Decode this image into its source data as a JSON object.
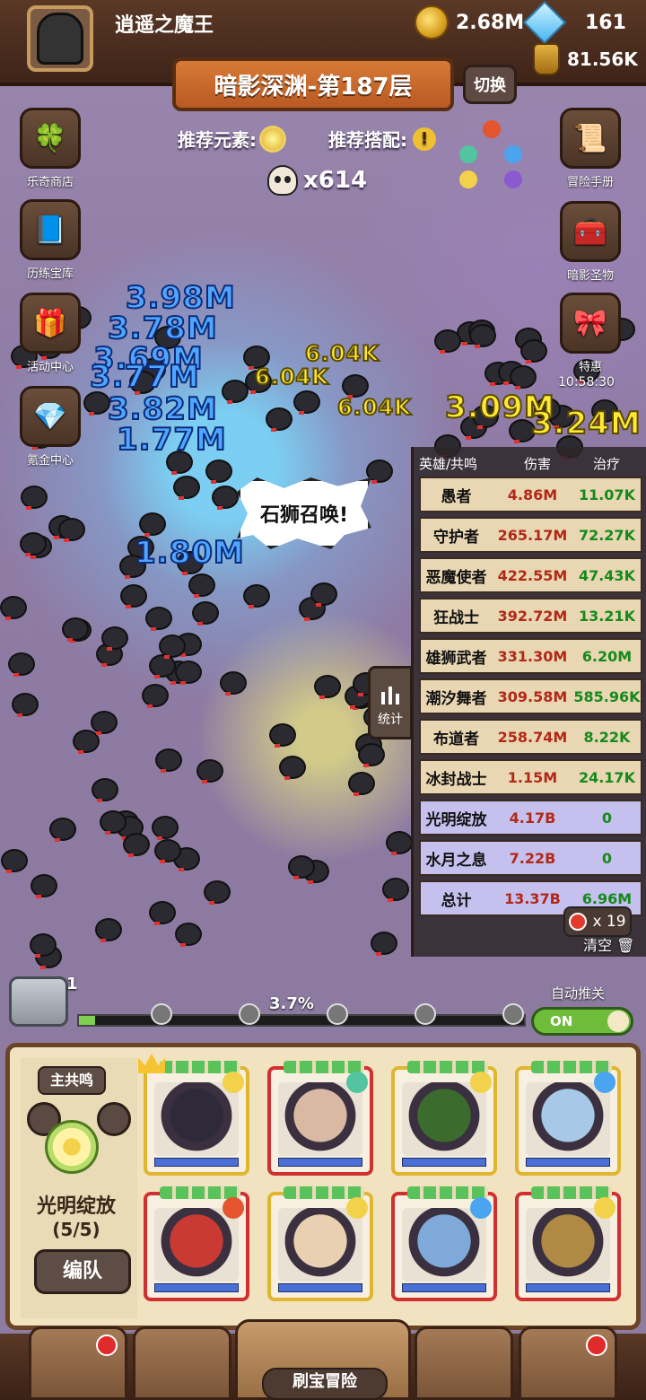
{
  "player": {
    "name": "逍遥之魔王"
  },
  "resources": {
    "gold": "2.68M",
    "gems": "161",
    "potion": "81.56K"
  },
  "stage": {
    "title": "暗影深渊-第187层",
    "switch_label": "切换"
  },
  "recommend": {
    "element_label": "推荐元素:",
    "combo_label": "推荐搭配:"
  },
  "kills": "x614",
  "left_menu": [
    {
      "label": "乐奇商店",
      "icon": "clover-icon"
    },
    {
      "label": "历练宝库",
      "icon": "book-icon"
    },
    {
      "label": "活动中心",
      "icon": "gift-icon"
    },
    {
      "label": "氪金中心",
      "icon": "diamond-icon"
    }
  ],
  "right_menu": [
    {
      "label": "冒险手册",
      "icon": "scroll-icon"
    },
    {
      "label": "暗影圣物",
      "icon": "treasure-chest-icon"
    },
    {
      "label": "特惠",
      "icon": "purple-chest-icon"
    }
  ],
  "timer": "10:58:30",
  "floating": {
    "blue": [
      "3.98M",
      "3.78M",
      "3.69M",
      "3.77M",
      "3.82M",
      "1.77M",
      "1.80M"
    ],
    "yellow_small": [
      "6.04K",
      "6.04K",
      "6.04K"
    ],
    "yellow_big": [
      "3.09M",
      "3.24M"
    ]
  },
  "callout": "石狮召唤!",
  "stats": {
    "tab_label": "统计",
    "headers": [
      "英雄/共鸣",
      "伤害",
      "治疗"
    ],
    "rows": [
      {
        "name": "愚者",
        "damage": "4.86M",
        "heal": "11.07K",
        "style": "hero"
      },
      {
        "name": "守护者",
        "damage": "265.17M",
        "heal": "72.27K",
        "style": "hero"
      },
      {
        "name": "恶魔使者",
        "damage": "422.55M",
        "heal": "47.43K",
        "style": "hero"
      },
      {
        "name": "狂战士",
        "damage": "392.72M",
        "heal": "13.21K",
        "style": "hero"
      },
      {
        "name": "雄狮武者",
        "damage": "331.30M",
        "heal": "6.20M",
        "style": "hero"
      },
      {
        "name": "潮汐舞者",
        "damage": "309.58M",
        "heal": "585.96K",
        "style": "hero"
      },
      {
        "name": "布道者",
        "damage": "258.74M",
        "heal": "8.22K",
        "style": "hero"
      },
      {
        "name": "冰封战士",
        "damage": "1.15M",
        "heal": "24.17K",
        "style": "hero"
      },
      {
        "name": "光明绽放",
        "damage": "4.17B",
        "heal": "0",
        "style": "resonance"
      },
      {
        "name": "水月之息",
        "damage": "7.22B",
        "heal": "0",
        "style": "resonance"
      },
      {
        "name": "总计",
        "damage": "13.37B",
        "heal": "6.96M",
        "style": "total"
      }
    ],
    "badge": "x 19",
    "clear_label": "清空"
  },
  "progress": {
    "chest_count": "1",
    "percent_label": "3.7%",
    "fraction": 0.037
  },
  "auto_push": {
    "label": "自动推关",
    "state": "ON"
  },
  "team": {
    "resonance_button": "主共鸣",
    "resonance_name": "光明绽放",
    "resonance_count": "(5/5)",
    "formation_button": "编队",
    "heroes": [
      {
        "id": "hooded-mage",
        "frame": "yellow",
        "element": "light",
        "face": "#2f2a3a"
      },
      {
        "id": "scarred-man",
        "frame": "red",
        "element": "wind",
        "face": "#d9b9a2"
      },
      {
        "id": "green-hood",
        "frame": "yellow",
        "element": "light",
        "face": "#3c6b2e"
      },
      {
        "id": "ice-knight",
        "frame": "yellow",
        "element": "water",
        "face": "#a8c8e8"
      },
      {
        "id": "red-demon",
        "frame": "red",
        "element": "fire",
        "face": "#c83a32"
      },
      {
        "id": "crowned-king",
        "frame": "yellow",
        "element": "light",
        "face": "#e9d0b0"
      },
      {
        "id": "blue-hair",
        "frame": "red",
        "element": "water",
        "face": "#7fa9d8"
      },
      {
        "id": "spartan",
        "frame": "red",
        "element": "light",
        "face": "#b08a44"
      }
    ]
  },
  "nav": {
    "center_label": "刷宝冒险"
  },
  "colors": {
    "light": "#f2d24a",
    "water": "#4aa4f0",
    "fire": "#e4542e",
    "wind": "#52c4a0"
  }
}
